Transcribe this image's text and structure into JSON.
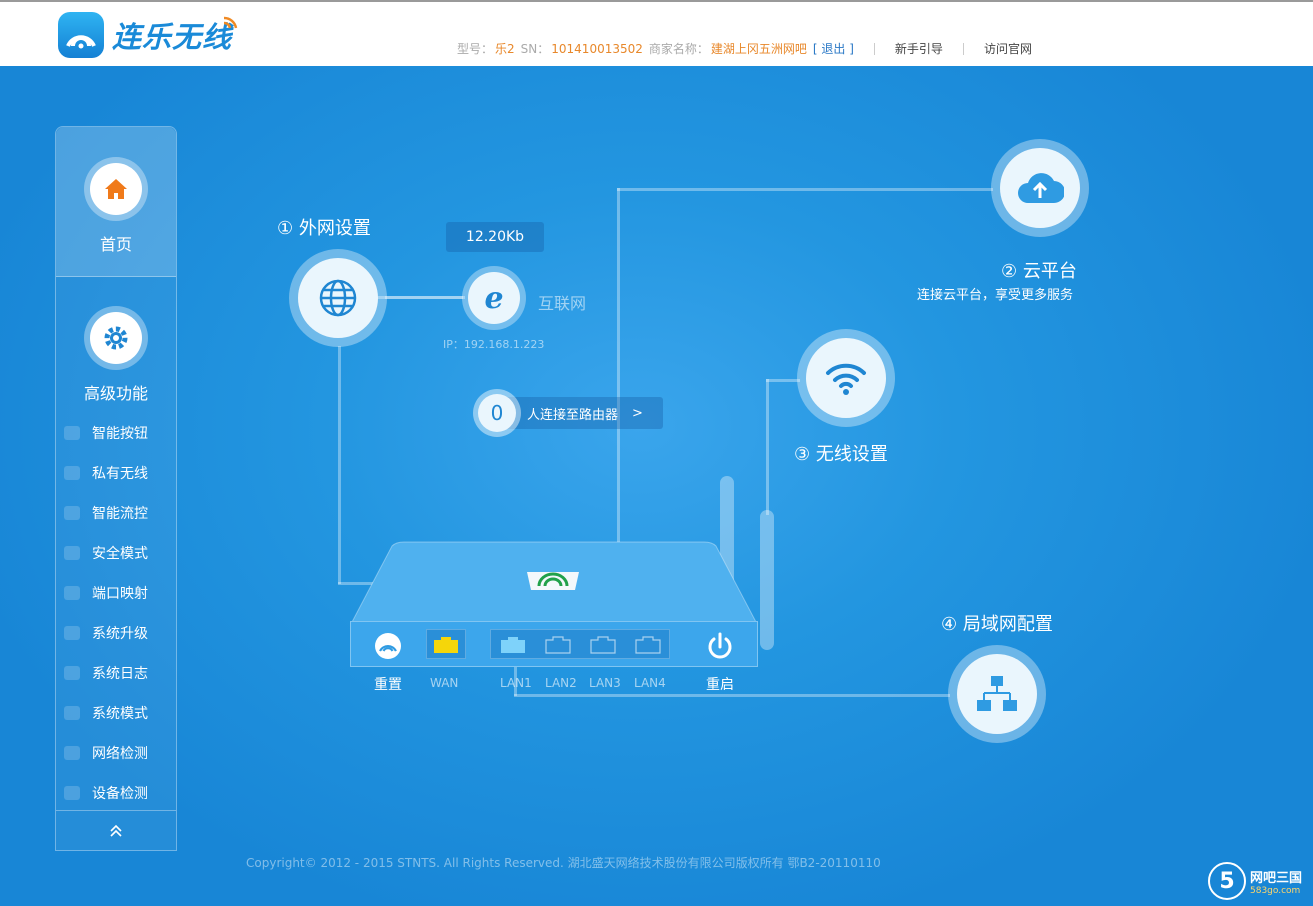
{
  "header": {
    "logo_text": "连乐无线",
    "model_label": "型号：",
    "model_value": "乐2",
    "sn_label": "SN：",
    "sn_value": "101410013502",
    "merchant_label": "商家名称：",
    "merchant_value": "建湖上冈五洲网吧",
    "logout": "[ 退出 ]",
    "guide_link": "新手引导",
    "official_link": "访问官网"
  },
  "sidebar": {
    "home_label": "首页",
    "advanced_label": "高级功能",
    "items": [
      {
        "label": "智能按钮"
      },
      {
        "label": "私有无线"
      },
      {
        "label": "智能流控"
      },
      {
        "label": "安全模式"
      },
      {
        "label": "端口映射"
      },
      {
        "label": "系统升级"
      },
      {
        "label": "系统日志"
      },
      {
        "label": "系统模式"
      },
      {
        "label": "网络检测"
      },
      {
        "label": "设备检测"
      }
    ],
    "collapse_icon": "double-chevron-up-icon"
  },
  "wan": {
    "title": "① 外网设置",
    "speed": "12.20Kb",
    "internet_label": "互联网",
    "ip": "IP：192.168.1.223"
  },
  "cloud": {
    "title": "② 云平台",
    "subtitle": "连接云平台，享受更多服务"
  },
  "wireless": {
    "title": "③ 无线设置"
  },
  "lan": {
    "title": "④ 局域网配置"
  },
  "connections": {
    "count": "0",
    "text": "人连接至路由器",
    "arrow": ">"
  },
  "router": {
    "reset_label": "重置",
    "wan_label": "WAN",
    "lan_labels": [
      "LAN1",
      "LAN2",
      "LAN3",
      "LAN4"
    ],
    "reboot_label": "重启"
  },
  "footer": {
    "copyright": "Copyright© 2012 - 2015 STNTS. All Rights Reserved. 湖北盛天网络技术股份有限公司版权所有 鄂B2-20110110"
  },
  "watermark": {
    "num": "5",
    "name": "网吧三国",
    "site": "583go.com"
  },
  "colors": {
    "accent": "#1e8fd9",
    "highlight": "#e8882b",
    "wan_port": "#f5d60a"
  }
}
